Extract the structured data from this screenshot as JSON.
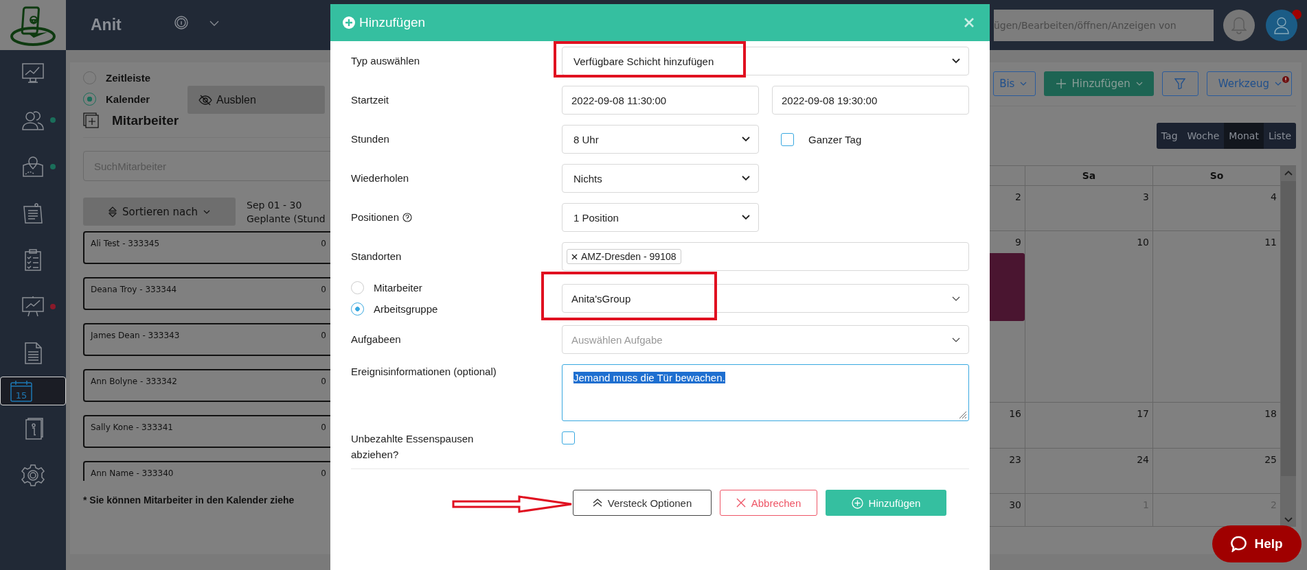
{
  "header": {
    "app_name": "Anit",
    "search": {
      "placeholder": "ügen/Bearbeiten/öffnen/Anzeigen von"
    },
    "has_notification": true
  },
  "sidebar": {
    "items": [
      {
        "kind": "dashboard",
        "selected": false
      },
      {
        "kind": "people",
        "selected": false,
        "color": "#1a6e5a"
      },
      {
        "kind": "map",
        "selected": false,
        "color": "#1a6e5a"
      },
      {
        "kind": "notes",
        "selected": false
      },
      {
        "kind": "checklist",
        "selected": false
      },
      {
        "kind": "presentation",
        "selected": false,
        "color": "#8a1a2a"
      },
      {
        "kind": "document",
        "selected": false
      },
      {
        "kind": "calendar",
        "selected": true,
        "label": "15"
      },
      {
        "kind": "info",
        "selected": false
      },
      {
        "kind": "settings",
        "selected": false
      }
    ]
  },
  "view_modes": [
    {
      "label": "Zeitleiste",
      "selected": false
    },
    {
      "label": "Kalender",
      "selected": true
    }
  ],
  "hide_button": {
    "label": "Ausblen"
  },
  "employees": {
    "title": "Mitarbeiter",
    "search_placeholder": "SuchMitarbeiter",
    "sort_label": "Sortieren nach",
    "period": "Sep 01 - 30",
    "planned": "Geplante (Stund",
    "list": [
      {
        "name": "Ali Test - 333345",
        "hours": "0"
      },
      {
        "name": "Deana Troy - 333344",
        "hours": "0"
      },
      {
        "name": "James Dean - 333343",
        "hours": "0"
      },
      {
        "name": "Ann Bolyne - 333342",
        "hours": "0"
      },
      {
        "name": "Sally Kone - 333341",
        "hours": "0"
      },
      {
        "name": "Ann Name - 333340",
        "hours": "0"
      }
    ],
    "footnote": "* Sie können Mitarbeiter in den Kalender ziehe"
  },
  "toolbar": {
    "range_label": "Bis",
    "add_label": "Hinzufügen",
    "tools_label": "Werkzeug",
    "tools_alert": true
  },
  "view_tabs": [
    {
      "label": "Tag",
      "selected": false
    },
    {
      "label": "Woche",
      "selected": false
    },
    {
      "label": "Monat",
      "selected": true
    },
    {
      "label": "Liste",
      "selected": false
    }
  ],
  "calendar": {
    "columns": [
      "",
      "Sa",
      "So"
    ],
    "weeks": [
      [
        {
          "day": "2",
          "other_month": false
        },
        {
          "day": "3",
          "other_month": false
        },
        {
          "day": "4",
          "other_month": false
        }
      ],
      [
        {
          "day": "9",
          "other_month": false,
          "has_event": true
        },
        {
          "day": "10",
          "other_month": false
        },
        {
          "day": "11",
          "other_month": false
        }
      ],
      [
        {
          "day": "16",
          "other_month": false
        },
        {
          "day": "17",
          "other_month": false
        },
        {
          "day": "18",
          "other_month": false
        }
      ],
      [
        {
          "day": "23",
          "other_month": false
        },
        {
          "day": "24",
          "other_month": false
        },
        {
          "day": "25",
          "other_month": false
        }
      ],
      [
        {
          "day": "30",
          "other_month": false
        },
        {
          "day": "1",
          "other_month": true
        },
        {
          "day": "2",
          "other_month": true
        }
      ]
    ]
  },
  "help_button": {
    "label": "Help"
  },
  "modal": {
    "title": "Hinzufügen",
    "type": {
      "label": "Typ auswählen",
      "value": "Verfügbare Schicht hinzufügen",
      "highlighted": true
    },
    "start": {
      "label": "Startzeit",
      "from": "2022-09-08 11:30:00",
      "to": "2022-09-08 19:30:00"
    },
    "hours": {
      "label": "Stunden",
      "value": "8 Uhr",
      "all_day": {
        "label": "Ganzer Tag",
        "checked": false
      }
    },
    "repeat": {
      "label": "Wiederholen",
      "value": "Nichts"
    },
    "positions": {
      "label": "Positionen",
      "value": "1 Position"
    },
    "locations": {
      "label": "Standorten",
      "tags": [
        {
          "text": "AMZ-Dresden - 99108"
        }
      ]
    },
    "assignee": {
      "options": [
        {
          "label": "Mitarbeiter",
          "selected": false
        },
        {
          "label": "Arbeitsgruppe",
          "selected": true
        }
      ],
      "value": "Anita'sGroup",
      "highlighted": true
    },
    "tasks": {
      "label": "Aufgabeen",
      "placeholder": "Auswählen Aufgabe"
    },
    "info": {
      "label": "Ereignisinformationen (optional)",
      "value": "Jemand muss die Tür bewachen.",
      "text_selected": true
    },
    "unpaid": {
      "label": "Unbezahlte Essenspausen abziehen?",
      "checked": false
    },
    "buttons": [
      {
        "kind": "collapse",
        "label": "Versteck Optionen",
        "pointed_at": true
      },
      {
        "kind": "cancel",
        "label": "Abbrechen"
      },
      {
        "kind": "submit",
        "label": "Hinzufügen"
      }
    ]
  }
}
